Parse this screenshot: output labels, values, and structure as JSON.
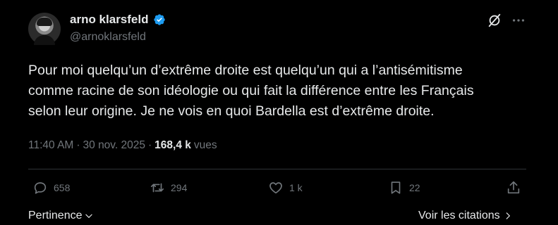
{
  "author": {
    "name": "arno klarsfeld",
    "handle": "@arnoklarsfeld",
    "verified": true,
    "verified_color": "#1d9bf0"
  },
  "tweet": {
    "lines": [
      "Pour moi quelqu’un d’extrême droite est quelqu’un qui a l’antisémitisme",
      "comme racine de son idéologie ou qui fait la différence entre les Français",
      "selon leur origine. Je ne vois en quoi Bardella est d’extrême droite."
    ],
    "time": "11:40 AM",
    "separator": "·",
    "date": "30 nov. 2025",
    "views_count": "168,4 k",
    "views_label": "vues"
  },
  "actions": {
    "replies": "658",
    "reposts": "294",
    "likes": "1 k",
    "bookmarks": "22"
  },
  "footer": {
    "sort_label": "Pertinence",
    "quotes_label": "Voir les citations"
  },
  "icons": {
    "grok": "grok-icon",
    "more": "more-icon",
    "reply": "reply-icon",
    "repost": "repost-icon",
    "like": "heart-icon",
    "bookmark": "bookmark-icon",
    "share": "share-icon",
    "chevron_down": "chevron-down-icon",
    "chevron_right": "chevron-right-icon"
  },
  "colors": {
    "background": "#000000",
    "text": "#e7e9ea",
    "secondary_text": "#71767b",
    "divider": "#2f3336"
  }
}
